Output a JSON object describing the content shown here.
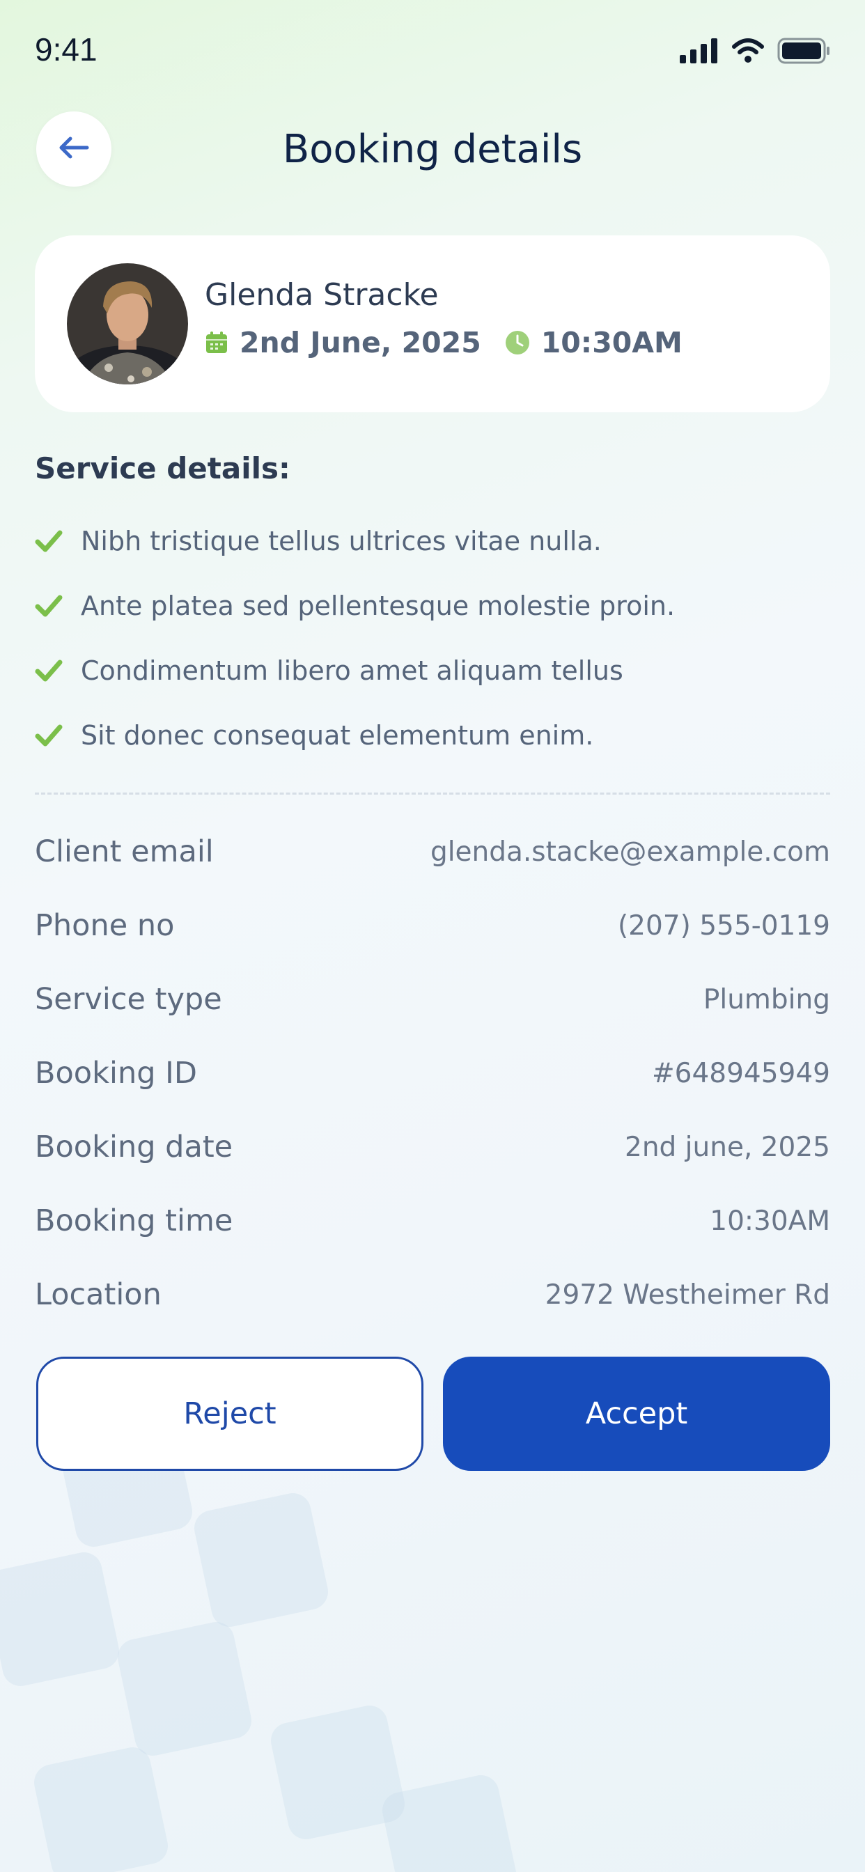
{
  "status_bar": {
    "time": "9:41"
  },
  "header": {
    "title": "Booking details"
  },
  "client": {
    "name": "Glenda Stracke",
    "date": "2nd June, 2025",
    "time": "10:30AM"
  },
  "service_section": {
    "title": "Service details:",
    "items": [
      "Nibh tristique tellus ultrices vitae nulla.",
      "Ante platea sed pellentesque molestie proin.",
      "Condimentum libero amet aliquam tellus",
      "Sit donec consequat elementum enim."
    ]
  },
  "details": [
    {
      "label": "Client email",
      "value": "glenda.stacke@example.com"
    },
    {
      "label": "Phone no",
      "value": "(207) 555-0119"
    },
    {
      "label": "Service type",
      "value": "Plumbing"
    },
    {
      "label": "Booking ID",
      "value": "#648945949"
    },
    {
      "label": "Booking date",
      "value": "2nd june, 2025"
    },
    {
      "label": "Booking time",
      "value": "10:30AM"
    },
    {
      "label": "Location",
      "value": "2972 Westheimer Rd"
    }
  ],
  "actions": {
    "reject_label": "Reject",
    "accept_label": "Accept"
  },
  "colors": {
    "primary": "#174cbb",
    "accent_green": "#7bbf4a",
    "title": "#0f2347"
  },
  "icons": {
    "back": "arrow-left-icon",
    "calendar": "calendar-icon",
    "clock": "clock-icon",
    "check": "check-icon",
    "signal": "signal-icon",
    "wifi": "wifi-icon",
    "battery": "battery-icon"
  }
}
